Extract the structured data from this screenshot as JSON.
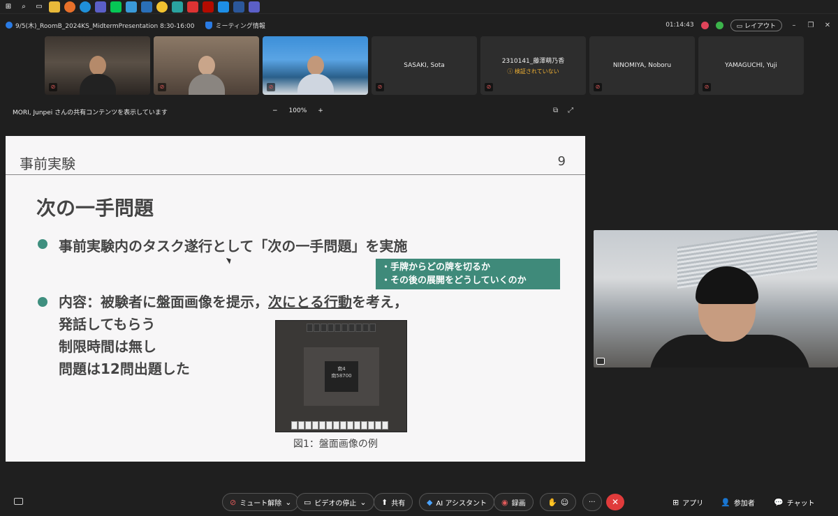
{
  "taskbar": {
    "icons": [
      "windows-icon",
      "search-icon",
      "task-view-icon",
      "explorer-icon",
      "firefox-icon",
      "edge-icon",
      "teams-icon",
      "line-icon",
      "app-icon",
      "app-icon",
      "chrome-icon",
      "app-icon",
      "pdf-icon",
      "acrobat-icon",
      "webex-icon",
      "word-icon",
      "teams-icon"
    ]
  },
  "window": {
    "title": "9/5(木)_RoomB_2024KS_MidtermPresentation 8:30-16:00",
    "meeting_info": "ミーティング情報",
    "time": "01:14:43",
    "layout_label": "レイアウト"
  },
  "participants": [
    {
      "name": "",
      "video": true
    },
    {
      "name": "",
      "video": true
    },
    {
      "name": "",
      "video": true
    },
    {
      "name": "SASAKI, Sota",
      "video": false
    },
    {
      "name": "2310141_藤澤萌乃香",
      "status": "検証されていない",
      "video": false
    },
    {
      "name": "NINOMIYA, Noboru",
      "video": false
    },
    {
      "name": "YAMAGUCHI, Yuji",
      "video": false
    }
  ],
  "share": {
    "label": "MORI, Junpei さんの共有コンテンツを表示しています",
    "zoom": "100%",
    "zoom_out": "−",
    "zoom_in": "+"
  },
  "slide": {
    "section": "事前実験",
    "page": "9",
    "heading": "次の一手問題",
    "bullet1": "事前実験内のタスク遂行として「次の一手問題」を実施",
    "callout_line1": "・手牌からどの牌を切るか",
    "callout_line2": "・その後の展開をどうしていくのか",
    "bullet2_pre": "内容：被験者に盤面画像を提示，",
    "bullet2_underline": "次にとる行動",
    "bullet2_post": "を考え，",
    "bullet2_line2": "発話してもらう",
    "bullet2_line3": "制限時間は無し",
    "bullet2_line4": "問題は12問出題した",
    "caption": "図1：盤面画像の例",
    "board_center_1": "南4",
    "board_center_2": "南58700"
  },
  "toolbar": {
    "mute": "ミュート解除",
    "video": "ビデオの停止",
    "share": "共有",
    "ai": "AI アシスタント",
    "record": "録画",
    "more": "···",
    "apps": "アプリ",
    "participants": "参加者",
    "chat": "チャット"
  }
}
